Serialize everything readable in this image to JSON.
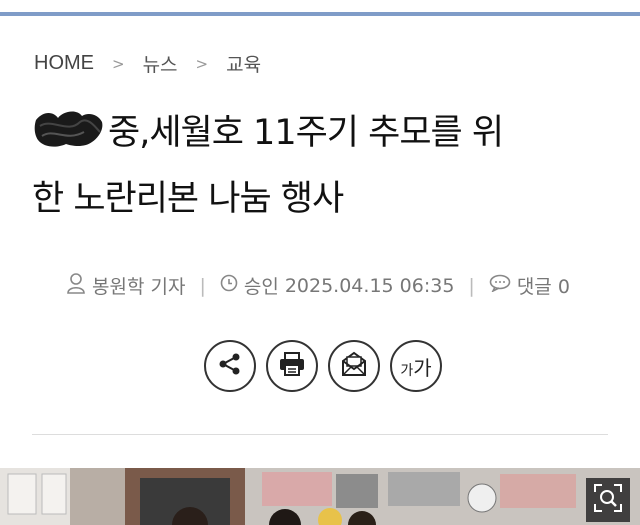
{
  "breadcrumb": {
    "home": "HOME",
    "items": [
      "뉴스",
      "교육"
    ],
    "separator": ">"
  },
  "article": {
    "title_part1": "중,세월호 11주기 추모를 위",
    "title_part2": "한 노란리본 나눔 행사",
    "author": "봉원학 기자",
    "approved_label": "승인",
    "datetime": "2025.04.15 06:35",
    "comments_label": "댓글",
    "comments_count": "0"
  },
  "actions": {
    "font_size_small": "가",
    "font_size_big": "가"
  },
  "colors": {
    "top_border": "#7f9cc8",
    "text_dark": "#111111",
    "meta_gray": "#777777"
  },
  "icons": [
    "person-icon",
    "clock-icon",
    "comment-icon",
    "share-icon",
    "print-icon",
    "email-icon",
    "font-size-icon",
    "zoom-icon"
  ]
}
